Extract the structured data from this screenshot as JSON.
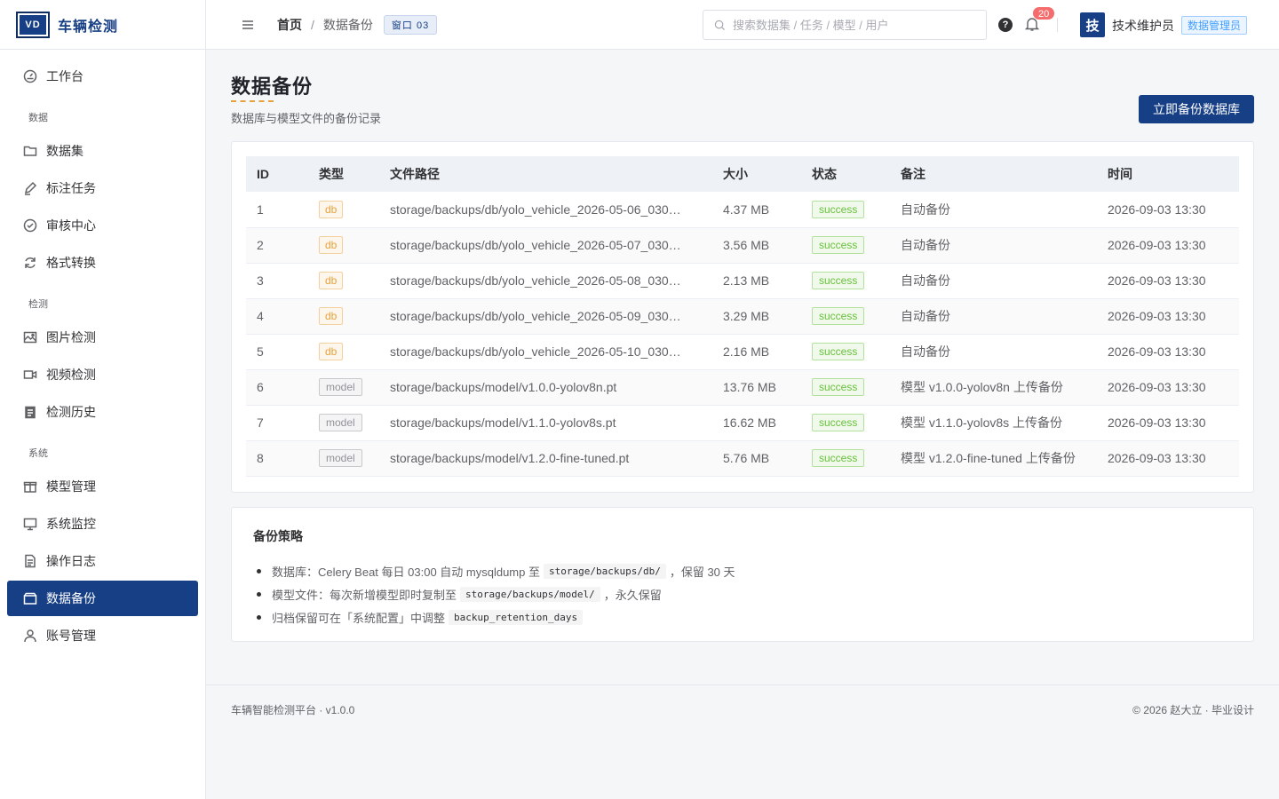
{
  "brand": {
    "logo": "VD",
    "name": "车辆检测"
  },
  "sidebar": {
    "workbench": "工作台",
    "group_data": "数据",
    "dataset": "数据集",
    "annotate": "标注任务",
    "review": "审核中心",
    "convert": "格式转换",
    "group_detect": "检测",
    "image_detect": "图片检测",
    "video_detect": "视频检测",
    "history": "检测历史",
    "group_system": "系统",
    "models": "模型管理",
    "monitor": "系统监控",
    "logs": "操作日志",
    "backup": "数据备份",
    "accounts": "账号管理"
  },
  "header": {
    "crumb_home": "首页",
    "crumb_sep": "/",
    "crumb_current": "数据备份",
    "window_tag": "窗口 03",
    "search_placeholder": "搜索数据集 / 任务 / 模型 / 用户",
    "help": "?",
    "notif_count": "20",
    "avatar": "技",
    "user_name": "技术维护员",
    "role": "数据管理员"
  },
  "page": {
    "title": "数据备份",
    "subtitle": "数据库与模型文件的备份记录",
    "backup_button": "立即备份数据库"
  },
  "table": {
    "columns": [
      "ID",
      "类型",
      "文件路径",
      "大小",
      "状态",
      "备注",
      "时间"
    ],
    "rows": [
      {
        "id": "1",
        "type": "db",
        "path": "storage/backups/db/yolo_vehicle_2026-05-06_030…",
        "size": "4.37 MB",
        "status": "success",
        "note": "自动备份",
        "time": "2026-09-03 13:30"
      },
      {
        "id": "2",
        "type": "db",
        "path": "storage/backups/db/yolo_vehicle_2026-05-07_030…",
        "size": "3.56 MB",
        "status": "success",
        "note": "自动备份",
        "time": "2026-09-03 13:30"
      },
      {
        "id": "3",
        "type": "db",
        "path": "storage/backups/db/yolo_vehicle_2026-05-08_030…",
        "size": "2.13 MB",
        "status": "success",
        "note": "自动备份",
        "time": "2026-09-03 13:30"
      },
      {
        "id": "4",
        "type": "db",
        "path": "storage/backups/db/yolo_vehicle_2026-05-09_030…",
        "size": "3.29 MB",
        "status": "success",
        "note": "自动备份",
        "time": "2026-09-03 13:30"
      },
      {
        "id": "5",
        "type": "db",
        "path": "storage/backups/db/yolo_vehicle_2026-05-10_030…",
        "size": "2.16 MB",
        "status": "success",
        "note": "自动备份",
        "time": "2026-09-03 13:30"
      },
      {
        "id": "6",
        "type": "model",
        "path": "storage/backups/model/v1.0.0-yolov8n.pt",
        "size": "13.76 MB",
        "status": "success",
        "note": "模型 v1.0.0-yolov8n 上传备份",
        "time": "2026-09-03 13:30"
      },
      {
        "id": "7",
        "type": "model",
        "path": "storage/backups/model/v1.1.0-yolov8s.pt",
        "size": "16.62 MB",
        "status": "success",
        "note": "模型 v1.1.0-yolov8s 上传备份",
        "time": "2026-09-03 13:30"
      },
      {
        "id": "8",
        "type": "model",
        "path": "storage/backups/model/v1.2.0-fine-tuned.pt",
        "size": "5.76 MB",
        "status": "success",
        "note": "模型 v1.2.0-fine-tuned 上传备份",
        "time": "2026-09-03 13:30"
      }
    ]
  },
  "policy": {
    "title": "备份策略",
    "item1_pre": "数据库：Celery Beat 每日 03:00 自动 mysqldump 至",
    "item1_code": "storage/backups/db/",
    "item1_post": "，保留 30 天",
    "item2_pre": "模型文件：每次新增模型即时复制至",
    "item2_code": "storage/backups/model/",
    "item2_post": "，永久保留",
    "item3_pre": "归档保留可在「系统配置」中调整",
    "item3_code": "backup_retention_days"
  },
  "footer": {
    "left": "车辆智能检测平台 · v1.0.0",
    "right": "© 2026 赵大立 · 毕业设计"
  },
  "colors": {
    "primary": "#173f86",
    "accent": "#e6a23c",
    "success": "#67c23a",
    "danger": "#f56c6c"
  }
}
